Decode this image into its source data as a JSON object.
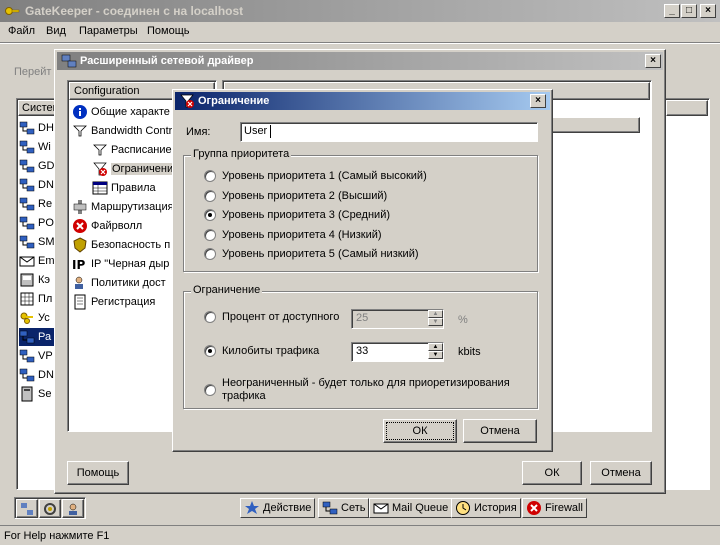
{
  "main_window": {
    "title": "GateKeeper - соединен с на localhost",
    "menu": [
      "Файл",
      "Вид",
      "Параметры",
      "Помощь"
    ],
    "toolbar_goto": "Перейт"
  },
  "side_list": {
    "header": "Систем",
    "items": [
      {
        "label": "DH",
        "icon": "network-icon"
      },
      {
        "label": "Wi",
        "icon": "network-icon"
      },
      {
        "label": "GD",
        "icon": "network-icon"
      },
      {
        "label": "DN",
        "icon": "network-icon"
      },
      {
        "label": "Re",
        "icon": "network-icon"
      },
      {
        "label": "PO",
        "icon": "network-icon"
      },
      {
        "label": "SM",
        "icon": "network-icon"
      },
      {
        "label": "Em",
        "icon": "mail-icon"
      },
      {
        "label": "Кэ",
        "icon": "cache-icon"
      },
      {
        "label": "Пл",
        "icon": "schedule-icon"
      },
      {
        "label": "Ус",
        "icon": "keys-icon"
      },
      {
        "label": "Ра",
        "icon": "network-icon"
      },
      {
        "label": "VP",
        "icon": "network-icon"
      },
      {
        "label": "DN",
        "icon": "network-icon"
      },
      {
        "label": "Se",
        "icon": "server-icon"
      }
    ],
    "selected_index": 11
  },
  "driver_window": {
    "title": "Расширенный сетевой драйвер",
    "tree_header": "Configuration",
    "tree": [
      {
        "label": "Общие характе",
        "icon": "info-icon",
        "indent": 0
      },
      {
        "label": "Bandwidth Contr",
        "icon": "filter-icon",
        "indent": 0
      },
      {
        "label": "Расписание",
        "icon": "filter-icon",
        "indent": 1
      },
      {
        "label": "Ограничени",
        "icon": "limit-icon",
        "indent": 1,
        "selected": true
      },
      {
        "label": "Правила",
        "icon": "table-icon",
        "indent": 1
      },
      {
        "label": "Маршрутизация",
        "icon": "route-icon",
        "indent": 0
      },
      {
        "label": "Файрволл",
        "icon": "firewall-icon",
        "indent": 0
      },
      {
        "label": "Безопасность п",
        "icon": "security-icon",
        "indent": 0
      },
      {
        "label": "IP \"Черная дыр",
        "icon": "ip-icon",
        "indent": 0
      },
      {
        "label": "Политики дост",
        "icon": "policy-icon",
        "indent": 0
      },
      {
        "label": "Регистрация",
        "icon": "register-icon",
        "indent": 0
      }
    ],
    "help_button": "Помощь",
    "ok_button": "ОК",
    "cancel_button": "Отмена"
  },
  "dialog": {
    "title": "Ограничение",
    "name_label": "Имя:",
    "name_value": "User",
    "priority_group_label": "Группа приоритета",
    "priorities": [
      "Уровень приоритета 1 (Самый высокий)",
      "Уровень приоритета 2 (Высший)",
      "Уровень приоритета 3 (Средний)",
      "Уровень приоритета 4 (Низкий)",
      "Уровень приоритета 5 (Самый низкий)"
    ],
    "priority_selected": 2,
    "limit_group_label": "Ограничение",
    "limit_percent_label": "Процент от доступного",
    "limit_percent_value": "25",
    "limit_percent_unit": "%",
    "limit_kbit_label": "Килобиты трафика",
    "limit_kbit_value": "33",
    "limit_kbit_unit": "kbits",
    "limit_none_label": "Неограниченный - будет только для приоретизирования трафика",
    "ok_button": "ОК",
    "cancel_button": "Отмена"
  },
  "bottom_tabs": [
    {
      "label": "Действие",
      "icon": "action-icon"
    },
    {
      "label": "Сеть",
      "icon": "network-icon"
    },
    {
      "label": "Mail Queue",
      "icon": "mail-icon"
    },
    {
      "label": "История",
      "icon": "history-icon"
    },
    {
      "label": "Firewall",
      "icon": "firewall-icon"
    }
  ],
  "status_bar": "For Help нажмите F1"
}
